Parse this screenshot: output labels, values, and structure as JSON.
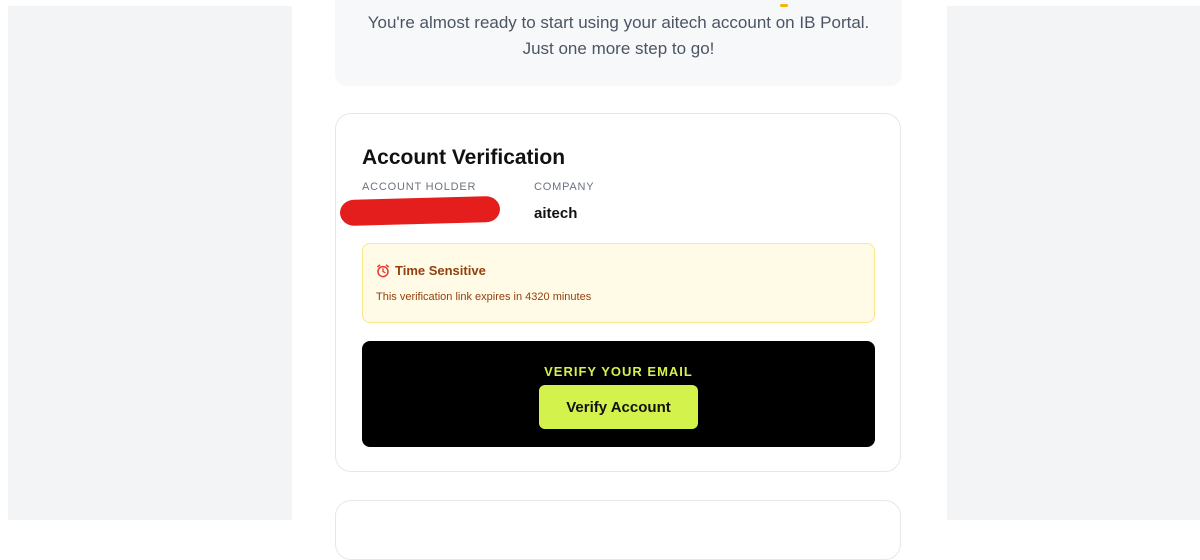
{
  "intro": {
    "line1": "You're almost ready to start using your aitech account on IB Portal.",
    "line2": "Just one more step to go!"
  },
  "card": {
    "title": "Account Verification",
    "account_holder_label": "ACCOUNT HOLDER",
    "company_label": "COMPANY",
    "company_value": "aitech"
  },
  "alert": {
    "icon": "alarm-clock-icon",
    "title": "Time Sensitive",
    "message": "This verification link expires in 4320 minutes"
  },
  "cta": {
    "label": "VERIFY YOUR EMAIL",
    "button_label": "Verify Account"
  },
  "colors": {
    "accent": "#d4f24c",
    "cta_background": "#000000",
    "warning_text": "#92400e",
    "warning_background": "#fffbe6",
    "redaction": "#e41d1d"
  }
}
